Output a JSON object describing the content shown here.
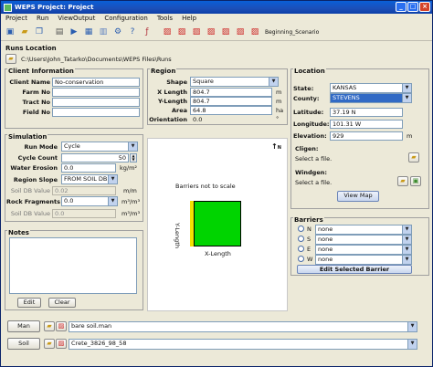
{
  "window": {
    "title": "WEPS Project: Project",
    "min": "_",
    "max": "□",
    "close": "×"
  },
  "menu": [
    "Project",
    "Run",
    "ViewOutput",
    "Configuration",
    "Tools",
    "Help"
  ],
  "toolbar": {
    "scenario_label": "Beginning_Scenario"
  },
  "runs_location": {
    "heading": "Runs Location",
    "path": "C:\\Users\\John_Tatarko\\Documents\\WEPS Files\\Runs"
  },
  "client": {
    "heading": "Client Information",
    "client_name_label": "Client Name",
    "client_name_value": "No-conservation",
    "farm_label": "Farm No",
    "tract_label": "Tract No",
    "field_label": "Field No"
  },
  "region": {
    "heading": "Region",
    "shape_label": "Shape",
    "shape_value": "Square",
    "xlength_label": "X Length",
    "xlength_value": "804.7",
    "ylength_label": "Y-Length",
    "ylength_value": "804.7",
    "area_label": "Area",
    "area_value": "64.8",
    "orientation_label": "Orientation",
    "orientation_value": "0.0",
    "unit_m": "m",
    "unit_ha": "ha",
    "unit_deg": "°"
  },
  "location": {
    "heading": "Location",
    "state_label": "State:",
    "state_value": "KANSAS",
    "county_label": "County:",
    "county_value": "STEVENS",
    "latitude_label": "Latitude:",
    "latitude_value": "37.19 N",
    "longitude_label": "Longitude:",
    "longitude_value": "101.31 W",
    "elevation_label": "Elevation:",
    "elevation_value": "929",
    "elevation_unit": "m",
    "cligen_label": "Cligen:",
    "cligen_value": "Select a file.",
    "windgen_label": "Windgen:",
    "windgen_value": "Select a file.",
    "view_map": "View Map"
  },
  "simulation": {
    "heading": "Simulation",
    "run_mode_label": "Run Mode",
    "run_mode_value": "Cycle",
    "cycle_count_label": "Cycle Count",
    "cycle_count_value": "50",
    "water_erosion_label": "Water Erosion",
    "water_erosion_value": "0.0",
    "water_erosion_unit": "kg/m²",
    "region_slope_label": "Region Slope",
    "region_slope_value": "FROM SOIL DB",
    "soil_db_value_label": "Soil DB Value",
    "soil_db_value": "0.02",
    "slope_unit": "m/m",
    "rock_fragments_label": "Rock Fragments",
    "rock_fragments_value": "0.0",
    "rock_unit": "m³/m³",
    "soil_db_value2_label": "Soil DB Value",
    "soil_db_value2": "0.0",
    "rock_unit2": "m³/m³"
  },
  "notes": {
    "heading": "Notes",
    "edit": "Edit",
    "clear": "Clear"
  },
  "map_view": {
    "caption": "Barriers not to scale",
    "xlength_label": "X-Length",
    "ylength_label": "Y-Length",
    "north": "N"
  },
  "barriers": {
    "heading": "Barriers",
    "items": [
      {
        "dir": "N",
        "value": "none"
      },
      {
        "dir": "S",
        "value": "none"
      },
      {
        "dir": "E",
        "value": "none"
      },
      {
        "dir": "W",
        "value": "none"
      }
    ],
    "edit_selected": "Edit Selected Barrier"
  },
  "bottom": {
    "man_label": "Man",
    "man_value": "bare soil.man",
    "soil_label": "Soil",
    "soil_value": "Crete_3826_98_58"
  },
  "colors": {
    "title_bar": "#1c4fb8",
    "field_square": "#00d400",
    "barrier": "#f2e200",
    "selected_row": "#316ac5"
  }
}
